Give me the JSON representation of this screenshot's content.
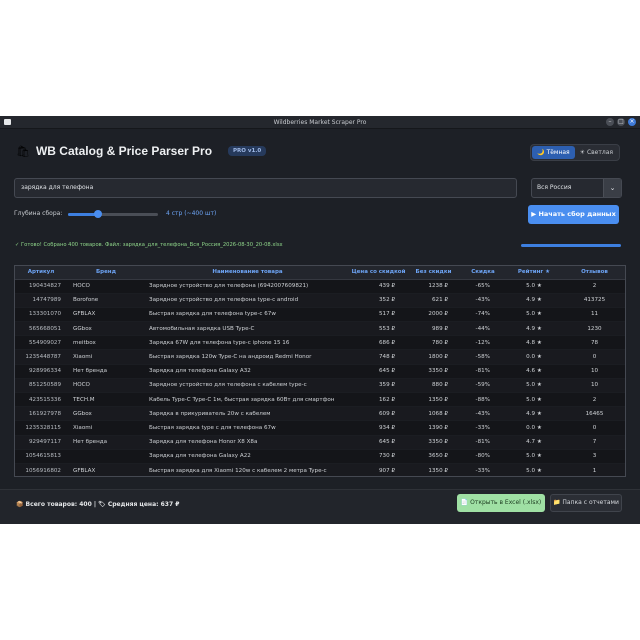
{
  "window": {
    "title": "Wildberries Market Scraper Pro"
  },
  "header": {
    "title": "WB Catalog & Price Parser Pro",
    "version": "PRO v1.0"
  },
  "theme": {
    "dark": "🌙 Тёмная",
    "light": "☀ Светлая"
  },
  "search": {
    "value": "зарядка для телефона"
  },
  "region": {
    "selected": "Вся Россия"
  },
  "depth": {
    "label": "Глубина сбора:",
    "value": "4 стр (~400 шт)",
    "fraction": 0.33
  },
  "start_button": "▶ Начать сбор данных",
  "status": "✓ Готово! Собрано 400 товаров. Файл: зарядка_для_телефона_Вся_Россия_2026-08-30_20-08.xlsx",
  "progress": 1.0,
  "table": {
    "headers": [
      "Артикул",
      "Бренд",
      "Наименование товара",
      "Цена со скидкой",
      "Без скидки",
      "Скидка",
      "Рейтинг ★",
      "Отзывов"
    ],
    "rows": [
      [
        "190434827",
        "HOCO",
        "Зарядное устройство для телефона (6942007609821)",
        "439 ₽",
        "1238 ₽",
        "-65%",
        "5.0 ★",
        "2"
      ],
      [
        "14747989",
        "Borofone",
        "Зарядное устройство для телефона type-c android",
        "352 ₽",
        "621 ₽",
        "-43%",
        "4.9 ★",
        "413725"
      ],
      [
        "133301070",
        "GFBLAX",
        "Быстрая зарядка для телефона type-c 67w",
        "517 ₽",
        "2000 ₽",
        "-74%",
        "5.0 ★",
        "11"
      ],
      [
        "565668051",
        "GGbox",
        "Автомобильная зарядка USB Type-C",
        "553 ₽",
        "989 ₽",
        "-44%",
        "4.9 ★",
        "1230"
      ],
      [
        "554909027",
        "meitbox",
        "Зарядка 67W для телефона type-c iphone 15 16",
        "686 ₽",
        "780 ₽",
        "-12%",
        "4.8 ★",
        "78"
      ],
      [
        "1235448787",
        "Xiaomi",
        "Быстрая зарядка 120w Type-C на андроид Redmi Honor",
        "748 ₽",
        "1800 ₽",
        "-58%",
        "0.0 ★",
        "0"
      ],
      [
        "928996334",
        "Нет бренда",
        "Зарядка для телефона Galaxy A32",
        "645 ₽",
        "3350 ₽",
        "-81%",
        "4.6 ★",
        "10"
      ],
      [
        "851250589",
        "HOCO",
        "Зарядное устройство для телефона с кабелем type-c",
        "359 ₽",
        "880 ₽",
        "-59%",
        "5.0 ★",
        "10"
      ],
      [
        "423515336",
        "TECH.M",
        "Кабель Type-C Type-C 1м, быстрая зарядка 60Вт для смартфон",
        "162 ₽",
        "1350 ₽",
        "-88%",
        "5.0 ★",
        "2"
      ],
      [
        "161927978",
        "GGbox",
        "Зарядка в прикуриватель 20w с кабелем",
        "609 ₽",
        "1068 ₽",
        "-43%",
        "4.9 ★",
        "16465"
      ],
      [
        "1235328115",
        "Xiaomi",
        "Быстрая зарядка type c для телефона 67w",
        "934 ₽",
        "1390 ₽",
        "-33%",
        "0.0 ★",
        "0"
      ],
      [
        "929497117",
        "Нет бренда",
        "Зарядка для телефона Honor X8 X8a",
        "645 ₽",
        "3350 ₽",
        "-81%",
        "4.7 ★",
        "7"
      ],
      [
        "1054615813",
        "",
        "Зарядка для телефона Galaxy A22",
        "730 ₽",
        "3650 ₽",
        "-80%",
        "5.0 ★",
        "3"
      ],
      [
        "1056916802",
        "GFBLAX",
        "Быстрая зарядка для Xiaomi 120w с кабелем 2 метра Type-c",
        "907 ₽",
        "1350 ₽",
        "-33%",
        "5.0 ★",
        "1"
      ]
    ]
  },
  "footer": {
    "totals": "📦 Всего товаров: 400  |  🏷 Средняя цена: 637 ₽",
    "excel_button": "📄 Открыть в Excel (.xlsx)",
    "folder_button": "📁 Папка с отчетами"
  }
}
